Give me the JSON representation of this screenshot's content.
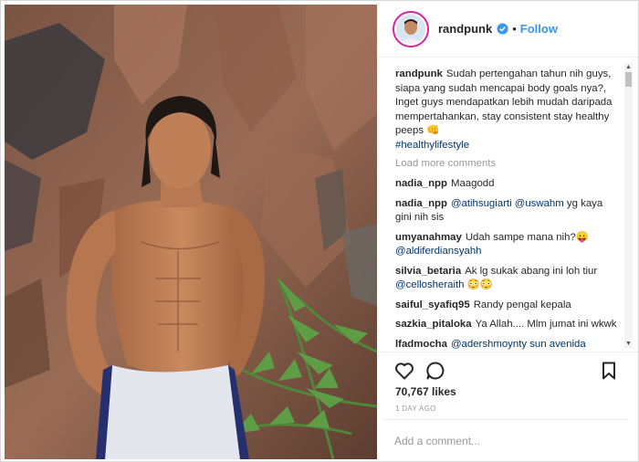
{
  "post": {
    "username": "randpunk",
    "follow_label": "Follow",
    "separator": "•",
    "caption": {
      "user": "randpunk",
      "text": "Sudah pertengahan tahun nih guys, siapa yang sudah mencapai body goals nya?, Inget guys mendapatkan lebih mudah daripada mempertahankan, stay consistent stay healthy peeps 👊",
      "hashtag": "#healthylifestyle"
    },
    "load_more_label": "Load more comments",
    "comments": [
      {
        "user": "nadia_npp",
        "text": "Maagodd"
      },
      {
        "user": "nadia_npp",
        "tags": "@atihsugiarti @uswahm",
        "text": " yg kaya gini nih sis"
      },
      {
        "user": "umyanahmay",
        "text": "Udah sampe mana nih?😛",
        "tags2": "@aldiferdiansyahh"
      },
      {
        "user": "silvia_betaria",
        "text": "Ak lg sukak abang ini loh tiur",
        "tags2": "@cellosheraith 😳😳"
      },
      {
        "user": "saiful_syafiq95",
        "text": "Randy pengal kepala"
      },
      {
        "user": "sazkia_pitaloka",
        "text": "Ya Allah.... Mlm jumat ini wkwk"
      },
      {
        "user": "lfadmocha",
        "tags": "@adershmoynty sun avenida",
        "text": ""
      }
    ],
    "likes": "70,767 likes",
    "time": "1 DAY AGO",
    "comment_placeholder": "Add a comment...",
    "colors": {
      "link": "#3897f0",
      "tag": "#003569",
      "muted": "#999999"
    }
  }
}
